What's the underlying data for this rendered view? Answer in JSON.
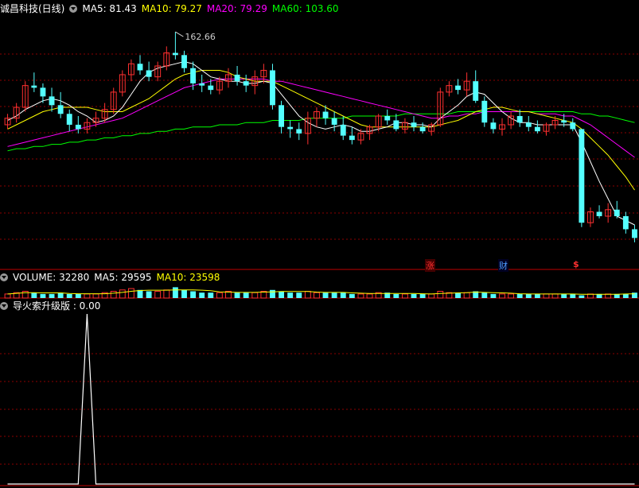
{
  "colors": {
    "up": "#ff3030",
    "down": "#54ffff",
    "ma5": "#ffffff",
    "ma10": "#ffff00",
    "ma20": "#ff00ff",
    "ma60": "#00ff00",
    "grid": "#8b0000",
    "border": "#c00000",
    "label": "#ffffff",
    "tag_red": "#ff3030",
    "tag_blue": "#4d9cff"
  },
  "header": {
    "stock": "诚昌科技(日线)",
    "ma5_label": "MA5: 81.43",
    "ma10_label": "MA10: 79.27",
    "ma20_label": "MA20: 79.29",
    "ma60_label": "MA60: 103.60"
  },
  "volume_header": {
    "volume_label": "VOLUME: 32280",
    "ma5_label": "MA5: 29595",
    "ma10_label": "MA10: 23598"
  },
  "indicator_header": {
    "label": "导火索升级版 : 0.00"
  },
  "annotations": {
    "high_label": "162.66",
    "tag_rise": "涨",
    "tag_finance": "财",
    "tag_dollar": "$"
  },
  "chart_data": {
    "type": "candlestick",
    "title": "诚昌科技(日线)",
    "price_range": [
      55,
      170
    ],
    "max_price": 162.66,
    "candles": [
      [
        120,
        125,
        118,
        123
      ],
      [
        123,
        130,
        121,
        128
      ],
      [
        128,
        140,
        126,
        138
      ],
      [
        138,
        144,
        135,
        137
      ],
      [
        137,
        139,
        130,
        133
      ],
      [
        133,
        137,
        126,
        129
      ],
      [
        129,
        135,
        123,
        125
      ],
      [
        125,
        127,
        117,
        120
      ],
      [
        120,
        124,
        116,
        118
      ],
      [
        118,
        123,
        116,
        121
      ],
      [
        121,
        126,
        119,
        123
      ],
      [
        123,
        130,
        121,
        127
      ],
      [
        127,
        137,
        125,
        135
      ],
      [
        135,
        145,
        133,
        143
      ],
      [
        143,
        150,
        140,
        148
      ],
      [
        148,
        152,
        143,
        145
      ],
      [
        145,
        149,
        140,
        142
      ],
      [
        142,
        149,
        140,
        147
      ],
      [
        147,
        156,
        145,
        153
      ],
      [
        153,
        162.66,
        150,
        152
      ],
      [
        152,
        154,
        144,
        146
      ],
      [
        146,
        149,
        136,
        139
      ],
      [
        139,
        143,
        135,
        138
      ],
      [
        138,
        141,
        134,
        136
      ],
      [
        136,
        142,
        134,
        140
      ],
      [
        140,
        146,
        137,
        143
      ],
      [
        143,
        147,
        138,
        140
      ],
      [
        140,
        143,
        135,
        138
      ],
      [
        138,
        145,
        134,
        142
      ],
      [
        142,
        148,
        139,
        145
      ],
      [
        145,
        148,
        127,
        129
      ],
      [
        129,
        131,
        116,
        119
      ],
      [
        119,
        122,
        114,
        118
      ],
      [
        118,
        121,
        113,
        116
      ],
      [
        116,
        126,
        111,
        123
      ],
      [
        123,
        128,
        119,
        126
      ],
      [
        126,
        129,
        120,
        123
      ],
      [
        123,
        126,
        117,
        120
      ],
      [
        120,
        124,
        113,
        115
      ],
      [
        115,
        119,
        111,
        113
      ],
      [
        113,
        118,
        111,
        116
      ],
      [
        116,
        120,
        113,
        119
      ],
      [
        119,
        125,
        117,
        124
      ],
      [
        124,
        127,
        120,
        122
      ],
      [
        122,
        125,
        117,
        118
      ],
      [
        118,
        123,
        116,
        121
      ],
      [
        121,
        124,
        117,
        119
      ],
      [
        119,
        121,
        116,
        117
      ],
      [
        117,
        121,
        115,
        120
      ],
      [
        120,
        137,
        119,
        135
      ],
      [
        135,
        140,
        133,
        138
      ],
      [
        138,
        141,
        134,
        136
      ],
      [
        136,
        144,
        133,
        140
      ],
      [
        140,
        145,
        130,
        131
      ],
      [
        131,
        133,
        119,
        121
      ],
      [
        121,
        123,
        116,
        118
      ],
      [
        118,
        123,
        115,
        120
      ],
      [
        120,
        126,
        118,
        124
      ],
      [
        124,
        127,
        119,
        121
      ],
      [
        121,
        124,
        117,
        119
      ],
      [
        119,
        122,
        116,
        117
      ],
      [
        117,
        121,
        115,
        120
      ],
      [
        120,
        124,
        118,
        122
      ],
      [
        122,
        125,
        119,
        121
      ],
      [
        121,
        123,
        117,
        118
      ],
      [
        118,
        80,
        73,
        75
      ],
      [
        75,
        82,
        73,
        80
      ],
      [
        80,
        83,
        77,
        78
      ],
      [
        78,
        84,
        75,
        81
      ],
      [
        81,
        85,
        77,
        78
      ],
      [
        78,
        80,
        70,
        72
      ],
      [
        72,
        74,
        66,
        68
      ]
    ],
    "ma5": [
      122,
      124,
      127,
      129,
      131,
      132,
      131,
      129,
      126,
      124,
      121,
      122,
      124,
      128,
      134,
      140,
      144,
      146,
      147,
      148,
      149,
      148,
      145,
      142,
      141,
      140,
      140,
      139,
      139,
      140,
      139,
      134,
      129,
      124,
      121,
      119,
      118,
      119,
      120,
      119,
      117,
      117,
      118,
      119,
      121,
      121,
      120,
      120,
      119,
      123,
      126,
      129,
      133,
      135,
      134,
      130,
      126,
      123,
      121,
      121,
      120,
      120,
      120,
      120,
      120,
      112,
      103,
      94,
      86,
      78,
      76,
      74
    ],
    "ma10": [
      118,
      120,
      122,
      124,
      126,
      127,
      128,
      128,
      128,
      128,
      127,
      126,
      126,
      126,
      128,
      130,
      132,
      135,
      138,
      141,
      143,
      144,
      145,
      145,
      145,
      144,
      142,
      141,
      140,
      140,
      140,
      138,
      136,
      134,
      132,
      130,
      128,
      126,
      124,
      122,
      120,
      119,
      119,
      119,
      119,
      119,
      119,
      119,
      119,
      120,
      121,
      122,
      124,
      126,
      127,
      128,
      128,
      127,
      126,
      126,
      125,
      124,
      123,
      122,
      121,
      118,
      114,
      110,
      106,
      101,
      96,
      90
    ],
    "ma20": [
      110,
      111,
      112,
      113,
      114,
      115,
      116,
      117,
      118,
      119,
      120,
      121,
      122,
      123,
      125,
      127,
      129,
      131,
      133,
      135,
      137,
      138,
      139,
      140,
      141,
      141,
      141,
      141,
      141,
      141,
      140,
      140,
      139,
      138,
      137,
      136,
      135,
      134,
      133,
      132,
      131,
      130,
      129,
      128,
      127,
      126,
      125,
      124,
      123,
      123,
      124,
      124,
      125,
      125,
      126,
      126,
      126,
      126,
      126,
      126,
      125,
      125,
      125,
      124,
      124,
      122,
      120,
      117,
      114,
      111,
      108,
      105
    ],
    "ma60": [
      108,
      109,
      109,
      110,
      110,
      111,
      111,
      112,
      112,
      113,
      113,
      114,
      114,
      115,
      115,
      116,
      116,
      117,
      117,
      118,
      118,
      119,
      119,
      119,
      120,
      120,
      120,
      121,
      121,
      121,
      122,
      122,
      122,
      122,
      123,
      123,
      123,
      123,
      123,
      124,
      124,
      124,
      124,
      124,
      124,
      125,
      125,
      125,
      125,
      125,
      125,
      126,
      126,
      126,
      126,
      126,
      126,
      126,
      126,
      126,
      126,
      126,
      126,
      126,
      126,
      125,
      125,
      124,
      124,
      123,
      122,
      121
    ],
    "volume": [
      3,
      4,
      5,
      4,
      3,
      3,
      4,
      3,
      3,
      3,
      3,
      4,
      5,
      6,
      7,
      6,
      5,
      5,
      6,
      8,
      6,
      5,
      4,
      4,
      4,
      5,
      4,
      4,
      4,
      5,
      6,
      5,
      4,
      4,
      5,
      4,
      4,
      4,
      4,
      3,
      3,
      3,
      4,
      4,
      3,
      3,
      3,
      3,
      3,
      5,
      4,
      4,
      4,
      5,
      4,
      3,
      3,
      3,
      3,
      3,
      3,
      3,
      3,
      3,
      3,
      2,
      3,
      3,
      3,
      3,
      3,
      4
    ],
    "indicator": [
      0,
      0,
      0,
      0,
      0,
      0,
      0,
      0,
      0,
      1,
      0,
      0,
      0,
      0,
      0,
      0,
      0,
      0,
      0,
      0,
      0,
      0,
      0,
      0,
      0,
      0,
      0,
      0,
      0,
      0,
      0,
      0,
      0,
      0,
      0,
      0,
      0,
      0,
      0,
      0,
      0,
      0,
      0,
      0,
      0,
      0,
      0,
      0,
      0,
      0,
      0,
      0,
      0,
      0,
      0,
      0,
      0,
      0,
      0,
      0,
      0,
      0,
      0,
      0,
      0,
      0,
      0,
      0,
      0,
      0,
      0,
      0
    ]
  }
}
